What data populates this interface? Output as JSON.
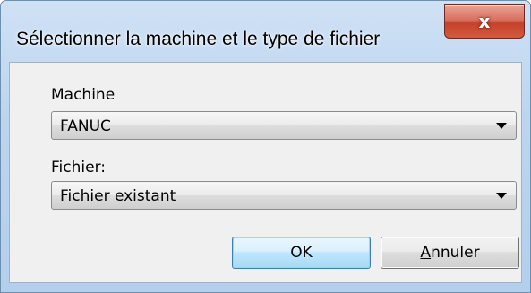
{
  "window": {
    "title": "Sélectionner la machine et le type de fichier",
    "close_icon": "close-icon",
    "close_glyph": "x"
  },
  "form": {
    "machine_label": "Machine",
    "machine_value": "FANUC",
    "fichier_label": "Fichier:",
    "fichier_value": "Fichier existant"
  },
  "buttons": {
    "ok_label": "OK",
    "cancel_mnemonic": "A",
    "cancel_rest": "nnuler"
  },
  "colors": {
    "close_button": "#c5412a",
    "ok_button_border": "#3c7fb1",
    "frame": "#bcd5ef"
  }
}
